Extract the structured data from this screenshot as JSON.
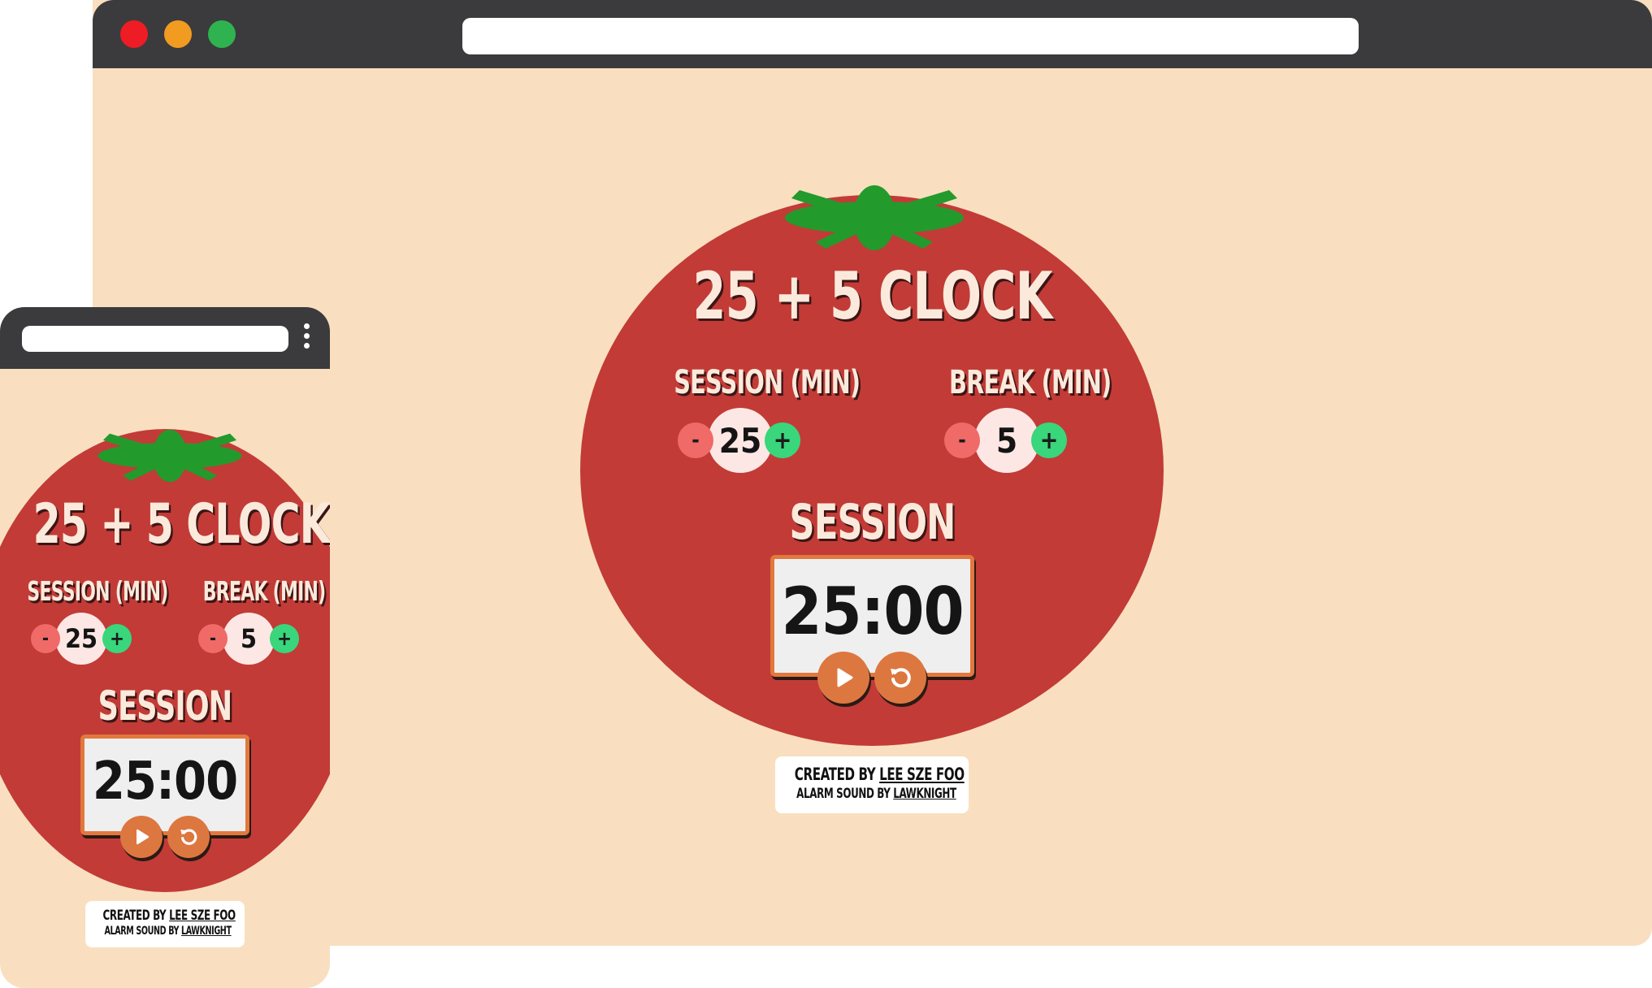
{
  "app": {
    "title": "25 + 5 CLOCK",
    "session_label": "SESSION (MIN)",
    "break_label": "BREAK (MIN)",
    "session_length": "25",
    "break_length": "5",
    "decrement_label": "-",
    "increment_label": "+",
    "timer_label": "SESSION",
    "time_left": "25:00",
    "credit": {
      "created_prefix": "CREATED BY ",
      "author": "LEE SZE FOO",
      "sound_prefix": "ALARM SOUND BY ",
      "sound_author": "LAWKNIGHT"
    }
  },
  "colors": {
    "background": "#f9dfbf",
    "tomato": "#c23b37",
    "leaf": "#239a2c",
    "decrement": "#f06a68",
    "increment": "#39d67c",
    "accent": "#dd7740",
    "browser_chrome": "#3b3b3d",
    "traffic_red": "#ee1c24",
    "traffic_yellow": "#f29b21",
    "traffic_green": "#2fb350"
  },
  "icons": {
    "play": "play-icon",
    "reset": "reset-icon"
  }
}
